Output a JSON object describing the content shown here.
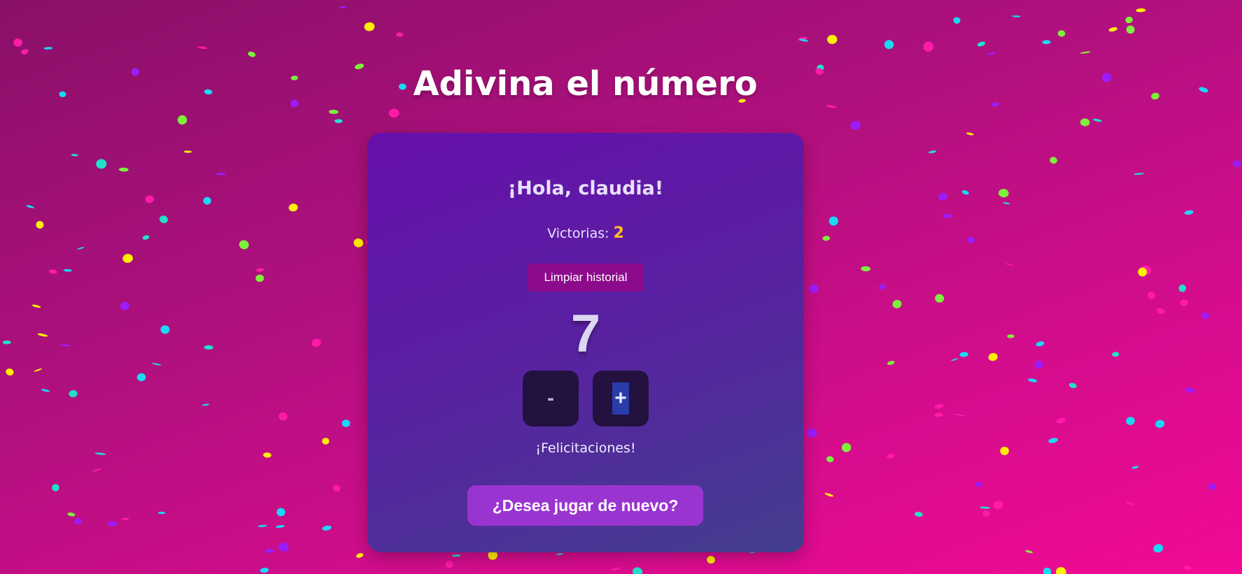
{
  "page": {
    "title": "Adivina el número"
  },
  "card": {
    "greeting": "¡Hola, claudia!",
    "wins_label": "Victorias:",
    "wins_count": "2",
    "clear_button": "Limpiar historial",
    "current_number": "7",
    "decrement_label": "-",
    "increment_label": "+",
    "message": "¡Felicitaciones!",
    "play_again_button": "¿Desea jugar de nuevo?"
  },
  "colors": {
    "background_start": "#8a1068",
    "background_end": "#f20a94",
    "card_start": "#6610aa",
    "card_end": "#433e8e",
    "wins_accent": "#ffc21a",
    "clear_button": "#8c0a8c",
    "play_button": "#9a34d0",
    "confetti": [
      "#ffee00",
      "#ff1aa8",
      "#22e0c8",
      "#7cf03a",
      "#9b1dff",
      "#1ad9f5"
    ]
  }
}
